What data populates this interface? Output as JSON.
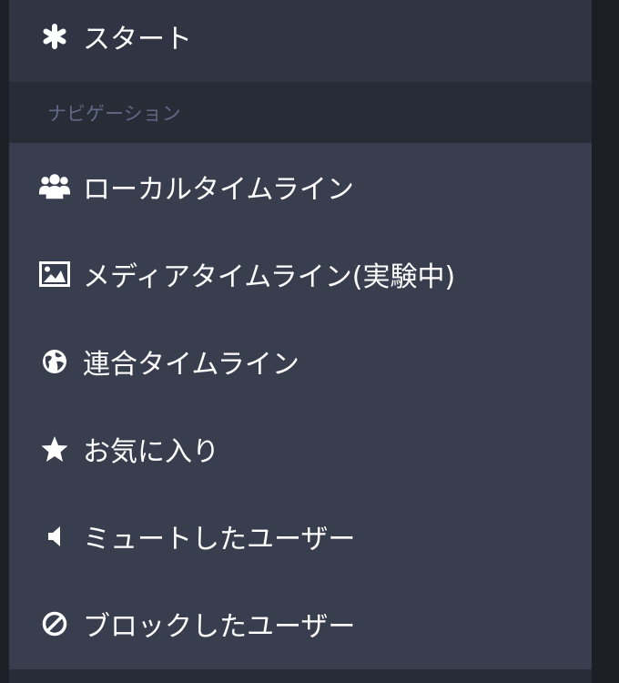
{
  "start": {
    "label": "スタート",
    "icon": "asterisk-icon"
  },
  "navigation": {
    "header": "ナビゲーション",
    "items": [
      {
        "label": "ローカルタイムライン",
        "icon": "users-icon"
      },
      {
        "label": "メディアタイムライン(実験中)",
        "icon": "image-icon"
      },
      {
        "label": "連合タイムライン",
        "icon": "globe-icon"
      },
      {
        "label": "お気に入り",
        "icon": "star-icon"
      },
      {
        "label": "ミュートしたユーザー",
        "icon": "volume-off-icon"
      },
      {
        "label": "ブロックしたユーザー",
        "icon": "ban-icon"
      }
    ]
  },
  "colors": {
    "panel": "#393e4f",
    "start_bg": "#313543",
    "header_bg": "#282c37",
    "header_text": "#606984",
    "text": "#ffffff"
  }
}
